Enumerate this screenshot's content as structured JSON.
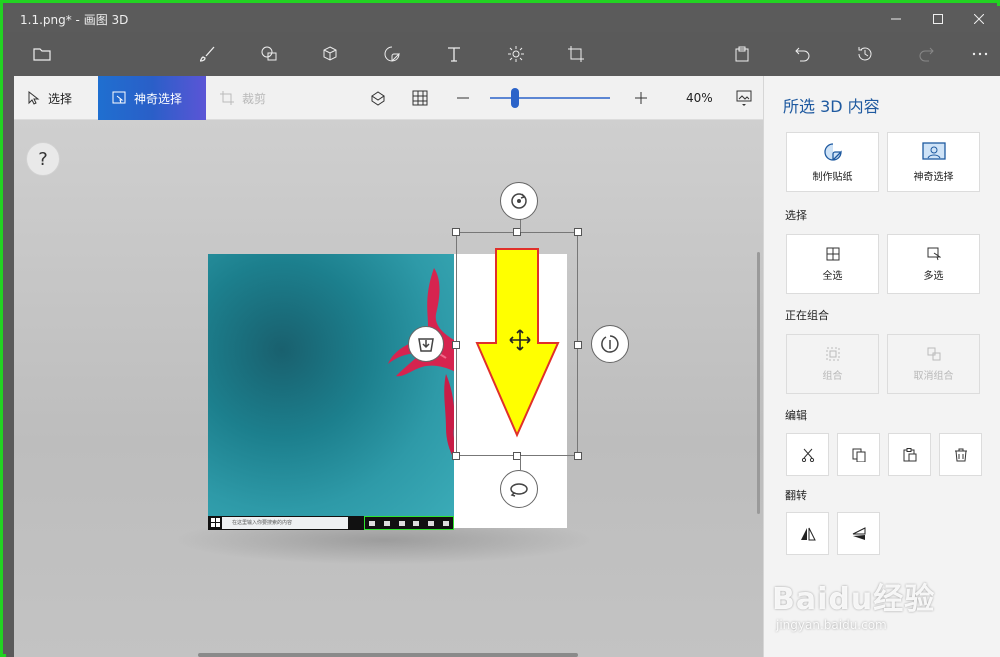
{
  "window": {
    "title": "1.1.png* - 画图 3D"
  },
  "subbar": {
    "select": "选择",
    "magic_select": "神奇选择",
    "crop": "裁剪",
    "zoom": "40%"
  },
  "canvas": {
    "help": "?",
    "taskbar_search": "在这里输入你要搜索的内容"
  },
  "panel": {
    "title": "所选 3D 内容",
    "make_sticker": "制作贴纸",
    "magic_select": "神奇选择",
    "section_select": "选择",
    "select_all": "全选",
    "multi_select": "多选",
    "section_group": "正在组合",
    "group": "组合",
    "ungroup": "取消组合",
    "section_edit": "编辑",
    "section_flip": "翻转"
  },
  "watermark": {
    "brand": "Baidu经验",
    "url": "jingyan.baidu.com"
  },
  "colors": {
    "accent": "#1f5aa0",
    "arrow_fill": "#ffff00",
    "arrow_stroke": "#e0302a",
    "frame": "#22d322"
  }
}
